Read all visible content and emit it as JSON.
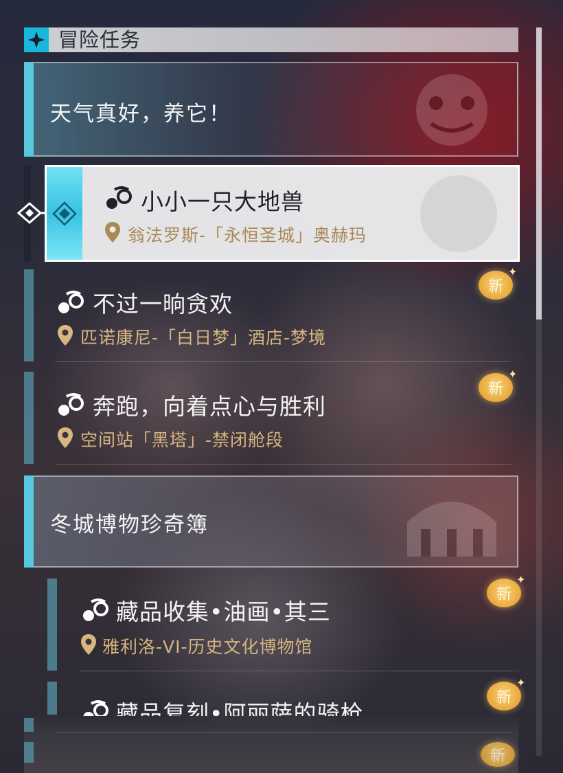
{
  "header": {
    "title": "冒险任务",
    "icon": "sparkle-icon"
  },
  "groups": [
    {
      "title": "天气真好，养它！",
      "emblem": "character-emblem-icon"
    },
    {
      "title": "冬城博物珍奇簿",
      "emblem": "museum-emblem-icon"
    }
  ],
  "selected": {
    "title": "小小一只大地兽",
    "location": "翁法罗斯-「永恒圣城」奥赫玛"
  },
  "quests": [
    {
      "title": "不过一晌贪欢",
      "location": "匹诺康尼-「白日梦」酒店-梦境",
      "badge": "新"
    },
    {
      "title": "奔跑，向着点心与胜利",
      "location": "空间站「黑塔」-禁闭舱段",
      "badge": "新"
    },
    {
      "title": "藏品收集•油画•其三",
      "location": "雅利洛-VI-历史文化博物馆",
      "badge": "新"
    },
    {
      "title": "藏品复刻•阿丽萨的骑枪",
      "badge": "新"
    },
    {
      "badge": "新"
    }
  ],
  "colors": {
    "accent": "#59c7dd",
    "location_gold": "#d7b67f",
    "badge": "#e9a93a"
  }
}
